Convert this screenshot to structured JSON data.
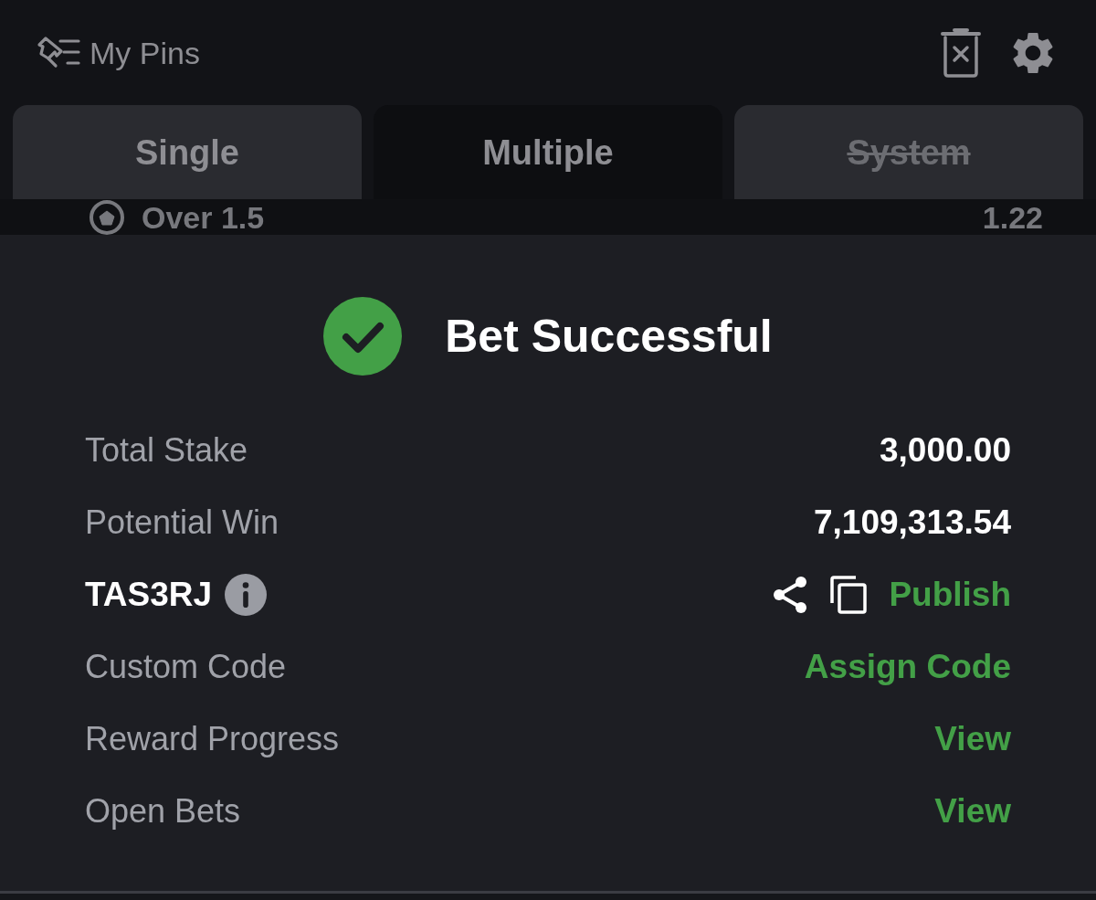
{
  "header": {
    "title": "My Pins"
  },
  "tabs": [
    {
      "label": "Single",
      "selected": false,
      "disabled": false
    },
    {
      "label": "Multiple",
      "selected": true,
      "disabled": false
    },
    {
      "label": "System",
      "selected": false,
      "disabled": true
    }
  ],
  "selection_row": {
    "market": "Over 1.5",
    "odds": "1.22"
  },
  "confirmation": {
    "title": "Bet Successful",
    "rows": [
      {
        "kind": "value",
        "label": "Total Stake",
        "value": "3,000.00"
      },
      {
        "kind": "value",
        "label": "Potential Win",
        "value": "7,109,313.54"
      },
      {
        "kind": "code",
        "label": "TAS3RJ",
        "action": "Publish"
      },
      {
        "kind": "action",
        "label": "Custom Code",
        "action": "Assign Code"
      },
      {
        "kind": "action",
        "label": "Reward Progress",
        "action": "View"
      },
      {
        "kind": "action",
        "label": "Open Bets",
        "action": "View"
      }
    ]
  }
}
